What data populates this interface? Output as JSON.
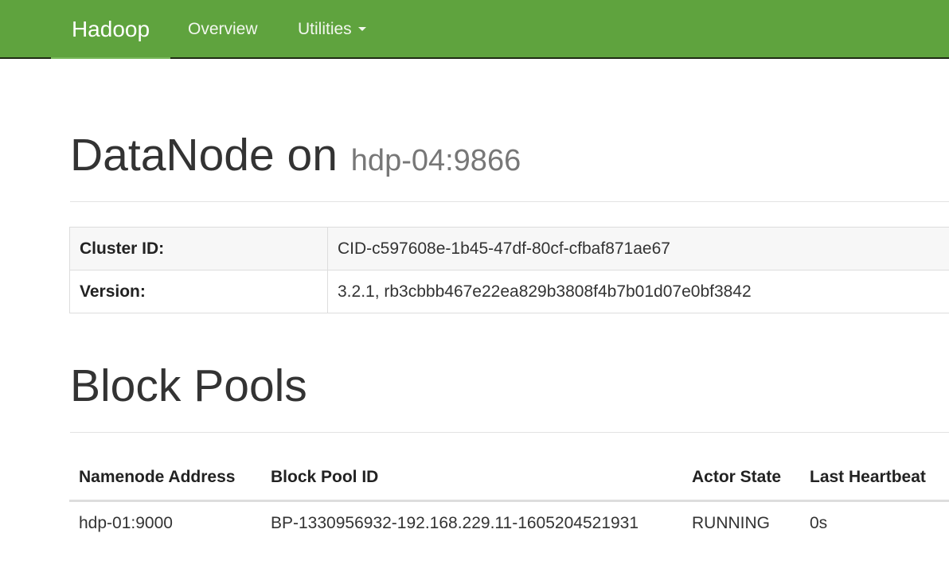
{
  "navbar": {
    "brand": "Hadoop",
    "overview": "Overview",
    "utilities": "Utilities",
    "background_color": "#5fa33e"
  },
  "header": {
    "title": "DataNode on",
    "host": "hdp-04:9866"
  },
  "info": {
    "cluster_id_label": "Cluster ID:",
    "cluster_id_value": "CID-c597608e-1b45-47df-80cf-cfbaf871ae67",
    "version_label": "Version:",
    "version_value": "3.2.1, rb3cbbb467e22ea829b3808f4b7b01d07e0bf3842"
  },
  "block_pools": {
    "title": "Block Pools",
    "columns": [
      "Namenode Address",
      "Block Pool ID",
      "Actor State",
      "Last Heartbeat"
    ],
    "rows": [
      [
        "hdp-01:9000",
        "BP-1330956932-192.168.229.11-1605204521931",
        "RUNNING",
        "0s"
      ]
    ]
  }
}
